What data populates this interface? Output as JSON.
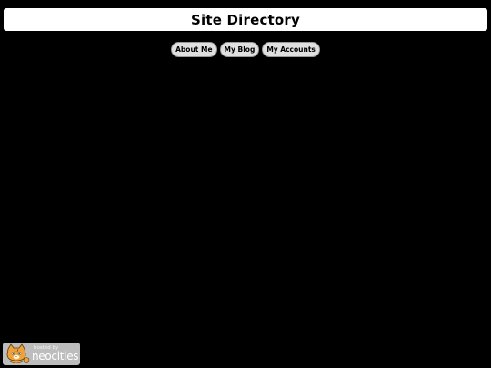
{
  "header": {
    "title": "Site Directory"
  },
  "nav": {
    "items": [
      {
        "label": "About Me"
      },
      {
        "label": "My Blog"
      },
      {
        "label": "My Accounts"
      }
    ]
  },
  "footer_badge": {
    "small_text": "hosted by",
    "big_text": "neocities",
    "icon": "neocities-cat-icon"
  },
  "colors": {
    "background": "#000000",
    "title_bar": "#ffffff",
    "button_fill": "#e0e0e0",
    "badge_fill": "#bdbdbd"
  }
}
